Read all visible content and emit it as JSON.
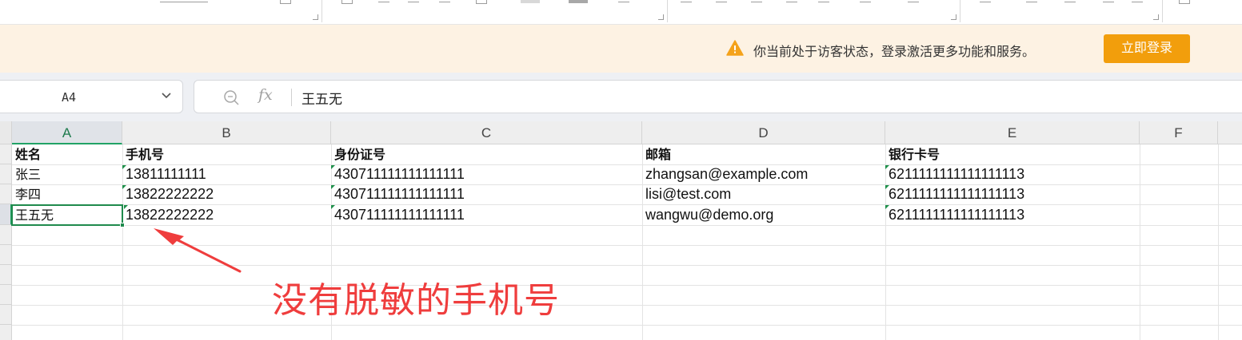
{
  "banner": {
    "message": "你当前处于访客状态，登录激活更多功能和服务。",
    "login_label": "立即登录",
    "warning_icon": "warning-icon",
    "accent": "#f29e0c",
    "background": "#fdf2e3"
  },
  "formula_bar": {
    "cell_ref": "A4",
    "fx_label": "fx",
    "value": "王五无"
  },
  "sheet": {
    "columns": [
      "A",
      "B",
      "C",
      "D",
      "E",
      "F"
    ],
    "selected_column": "A",
    "selected_cell": "A4",
    "headers": [
      "姓名",
      "手机号",
      "身份证号",
      "邮箱",
      "银行卡号"
    ],
    "rows": [
      [
        "张三",
        "13811111111",
        "430711111111111111",
        "zhangsan@example.com",
        "6211111111111111113"
      ],
      [
        "李四",
        "13822222222",
        "430711111111111111",
        "lisi@test.com",
        "6211111111111111113"
      ],
      [
        "王五无",
        "13822222222",
        "430711111111111111",
        "wangwu@demo.org",
        "6211111111111111113"
      ]
    ],
    "accent": "#21a366"
  },
  "annotation": {
    "text": "没有脱敏的手机号",
    "color": "#ef3d3d"
  }
}
